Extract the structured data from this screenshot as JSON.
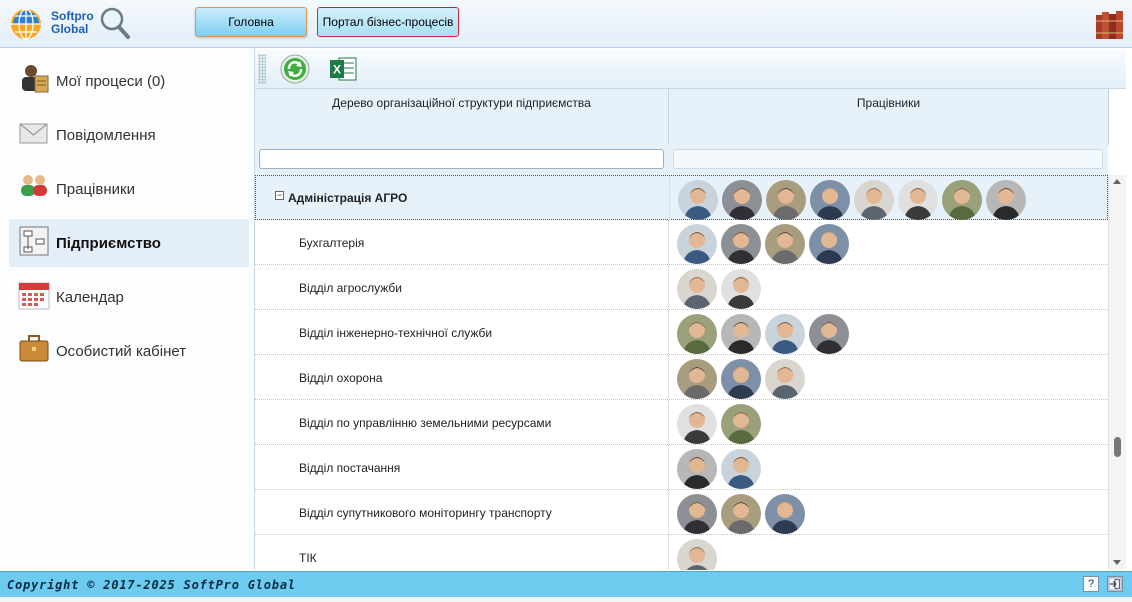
{
  "header": {
    "logo_line1": "Softpro",
    "logo_line2": "Global",
    "nav_home": "Головна",
    "nav_portal": "Портал бізнес-процесів"
  },
  "sidebar": {
    "items": [
      {
        "label": "Мої процеси (0)",
        "icon": "user-processes-icon"
      },
      {
        "label": "Повідомлення",
        "icon": "envelope-icon"
      },
      {
        "label": "Працівники",
        "icon": "people-icon"
      },
      {
        "label": "Підприємство",
        "icon": "org-chart-icon",
        "active": true
      },
      {
        "label": "Календар",
        "icon": "calendar-icon"
      },
      {
        "label": "Особистий кабінет",
        "icon": "briefcase-icon"
      }
    ]
  },
  "toolbar": {
    "refresh_icon": "refresh-icon",
    "excel_icon": "excel-export-icon"
  },
  "grid": {
    "col1_header": "Дерево організаційної структури підприємства",
    "col2_header": "Працівники",
    "filter1_value": "",
    "filter2_value": "",
    "rows": [
      {
        "name": "Адміністрація АГРО",
        "expanded": true,
        "avatars": 8
      },
      {
        "name": "Бухгалтерія",
        "avatars": 4
      },
      {
        "name": "Відділ агрослужби",
        "avatars": 2
      },
      {
        "name": "Відділ інженерно-технічної служби",
        "avatars": 4
      },
      {
        "name": "Відділ охорона",
        "avatars": 3
      },
      {
        "name": "Відділ по управлінню земельними ресурсами",
        "avatars": 2
      },
      {
        "name": "Відділ постачання",
        "avatars": 2
      },
      {
        "name": "Відділ супутникового моніторингу транспорту",
        "avatars": 3
      },
      {
        "name": "ТІК",
        "avatars": 1
      }
    ]
  },
  "footer": {
    "copyright": "Copyright © 2017-2025 SoftPro Global",
    "help_label": "?",
    "exit_icon": "exit-icon"
  },
  "colors": {
    "accent": "#6ccbee",
    "portal_border": "#d0243b",
    "selected_row": "#e6f1fa"
  }
}
